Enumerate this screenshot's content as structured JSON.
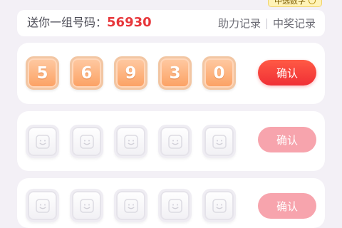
{
  "header": {
    "tag_label": "中选数字",
    "tag_icon": "question-circle-icon"
  },
  "info_bar": {
    "prefix": "送你一组号码：",
    "number": "56930",
    "links": [
      "助力记录",
      "中奖记录"
    ]
  },
  "rows": [
    {
      "digits": [
        "5",
        "6",
        "9",
        "3",
        "0"
      ],
      "button_label": "确认",
      "state": "active"
    },
    {
      "digits": [],
      "button_label": "确认",
      "state": "disabled"
    },
    {
      "digits": [],
      "button_label": "确认",
      "state": "disabled"
    }
  ],
  "colors": {
    "accent_red": "#f02f35",
    "disabled_red": "#f7a4ad",
    "tile_orange": "#fca062",
    "number_red": "#e7373b"
  }
}
